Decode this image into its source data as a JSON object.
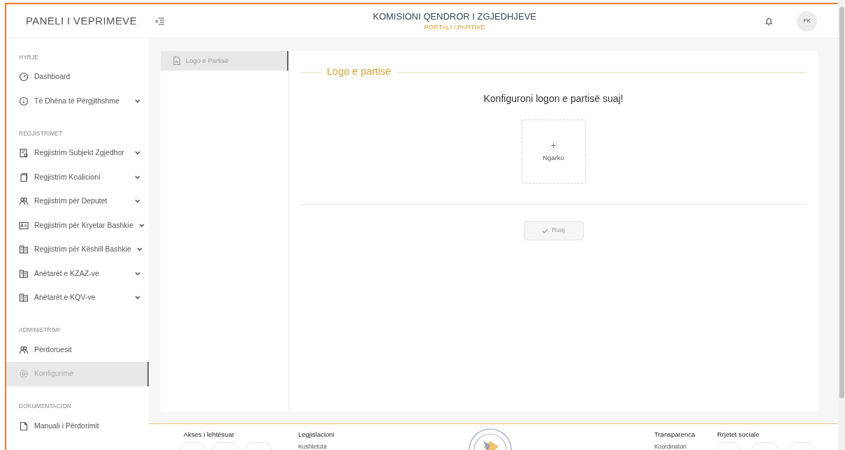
{
  "header": {
    "brand": "PANELI I VEPRIMEVE",
    "title": "KOMISIONI QENDROR I ZGJEDHJEVE",
    "subtitle": "PORTALI I PARTIVE",
    "avatar": "FK"
  },
  "sidebar": {
    "sections": [
      {
        "title": "HYRJE",
        "items": [
          {
            "label": "Dashboard",
            "kind": "dashboard",
            "expandable": false,
            "selected": false
          },
          {
            "label": "Të Dhëna të Përgjithshme",
            "kind": "info",
            "expandable": true,
            "selected": false
          }
        ]
      },
      {
        "title": "REGJISTRIMET",
        "items": [
          {
            "label": "Regjistrim Subjekt Zgjedhor",
            "kind": "form",
            "expandable": true,
            "selected": false
          },
          {
            "label": "Regjistrim Koalicioni",
            "kind": "copy",
            "expandable": true,
            "selected": false
          },
          {
            "label": "Regjistrim për Deputet",
            "kind": "people",
            "expandable": true,
            "selected": false
          },
          {
            "label": "Regjistrim për Kryetar Bashkie",
            "kind": "card",
            "expandable": true,
            "selected": false
          },
          {
            "label": "Regjistrim për Këshill Bashkie",
            "kind": "building",
            "expandable": true,
            "selected": false
          },
          {
            "label": "Anëtarët e KZAZ-ve",
            "kind": "building",
            "expandable": true,
            "selected": false
          },
          {
            "label": "Anëtarët e KQV-ve",
            "kind": "building",
            "expandable": true,
            "selected": false
          }
        ]
      },
      {
        "title": "ADMINISTRIMI",
        "items": [
          {
            "label": "Përdoruesit",
            "kind": "people",
            "expandable": false,
            "selected": false
          },
          {
            "label": "Konfigurime",
            "kind": "gear",
            "expandable": false,
            "selected": true
          }
        ]
      },
      {
        "title": "DOKUMENTACION",
        "items": [
          {
            "label": "Manuali i Përdorimit",
            "kind": "document",
            "expandable": false,
            "selected": false
          }
        ]
      }
    ]
  },
  "config_tabs": [
    {
      "label": "Logo e Partisë",
      "selected": true
    }
  ],
  "panel": {
    "legend": "Logo e partisë",
    "heading": "Konfiguroni logon e partisë suaj!",
    "upload": {
      "symbol": "+",
      "label": "Ngarko"
    },
    "save_button": {
      "label": "Ruaj",
      "disabled": true
    }
  },
  "footer": {
    "accessibility": {
      "title": "Akses i lehtësuar"
    },
    "legislation": {
      "title": "Legjislacioni",
      "links": [
        "Kushtetuta"
      ]
    },
    "transparency": {
      "title": "Transparenca",
      "links": [
        "Koordinatori"
      ]
    },
    "social": {
      "title": "Rrjetet sociale"
    }
  }
}
